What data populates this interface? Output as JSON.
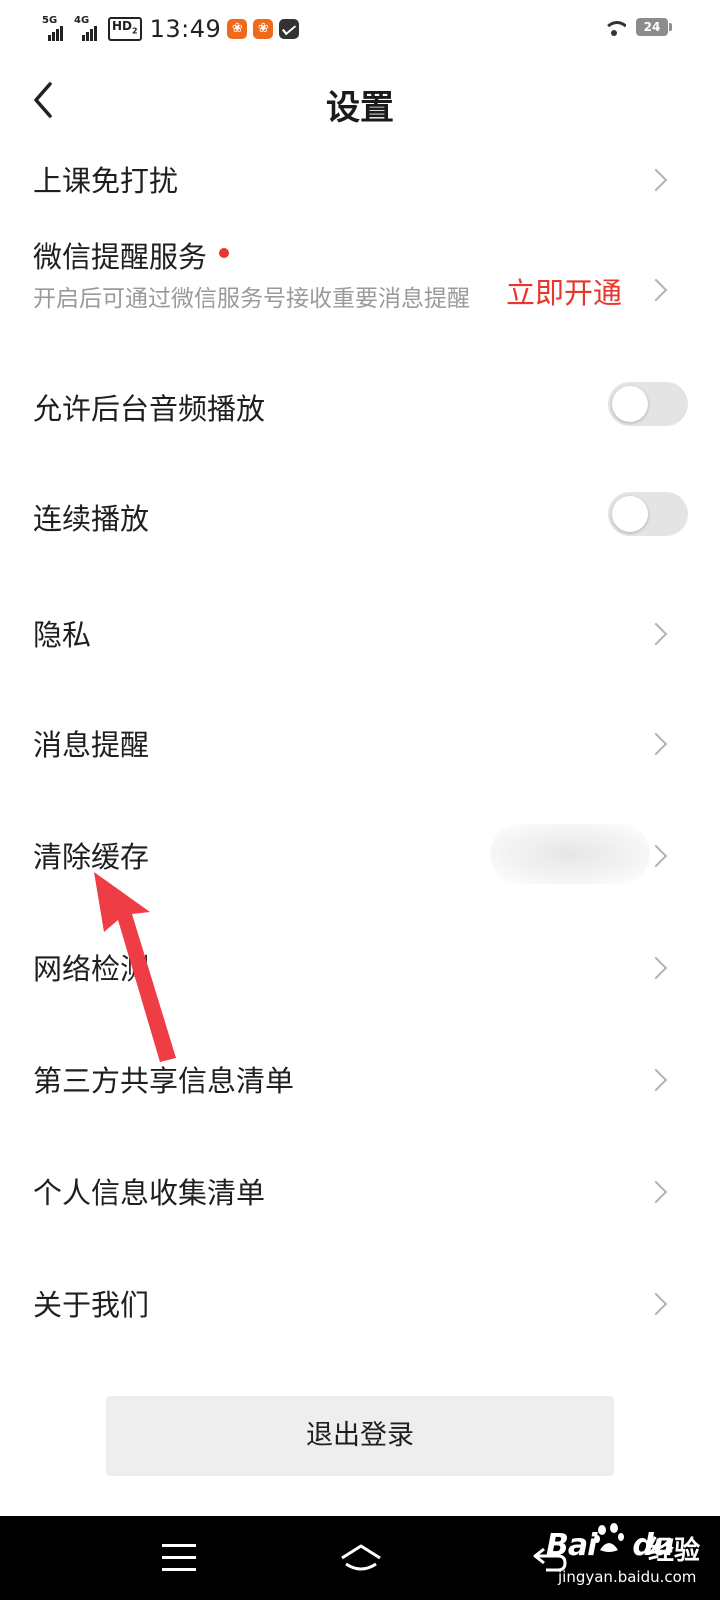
{
  "status_bar": {
    "net1": "5G",
    "net2": "4G",
    "hd": "HD",
    "hd_sub": "2",
    "time": "13:49",
    "app_icon": "app-notification-icon",
    "battery": "24"
  },
  "header": {
    "title": "设置"
  },
  "settings": {
    "do_not_disturb": "上课免打扰",
    "wechat_reminder": {
      "label": "微信提醒服务",
      "description": "开启后可通过微信服务号接收重要消息提醒",
      "action": "立即开通"
    },
    "background_audio": {
      "label": "允许后台音频播放",
      "enabled": false
    },
    "continuous_play": {
      "label": "连续播放",
      "enabled": false
    },
    "privacy": "隐私",
    "message_reminder": "消息提醒",
    "clear_cache": "清除缓存",
    "network_check": "网络检测",
    "third_party_list": "第三方共享信息清单",
    "personal_info_list": "个人信息收集清单",
    "about_us": "关于我们"
  },
  "logout_label": "退出登录",
  "watermark": {
    "brand": "Bai",
    "brand2": "du",
    "cn": "经验",
    "url": "jingyan.baidu.com"
  },
  "colors": {
    "accent_red": "#e8362c",
    "secondary_text": "#9a9a9a",
    "button_bg": "#eeeeee"
  }
}
